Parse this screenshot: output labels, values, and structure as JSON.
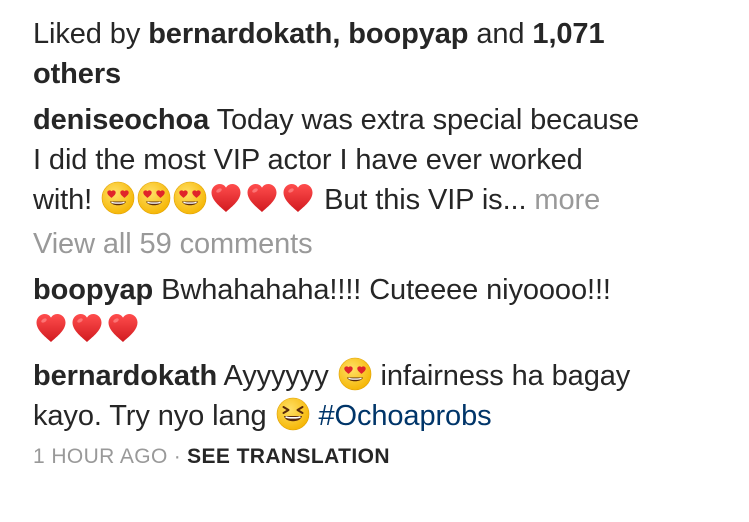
{
  "likes": {
    "prefix": "Liked by",
    "user1": "bernardokath",
    "sep": ",",
    "user2": "boopyap",
    "and": "and",
    "count": "1,071",
    "suffix": "others"
  },
  "caption": {
    "username": "deniseochoa",
    "text_line1": "Today was extra special because",
    "text_line2": "I did the most VIP actor I have ever worked",
    "text_line3_start": "with!",
    "text_after_emojis": "But this VIP is...",
    "more_label": "more",
    "emojis": [
      "heart-eyes-icon",
      "heart-eyes-icon",
      "heart-eyes-icon",
      "red-heart-icon",
      "red-heart-icon",
      "red-heart-icon"
    ]
  },
  "view_all_comments": "View all 59 comments",
  "comments": [
    {
      "username": "boopyap",
      "text": "Bwhahahaha!!!! Cuteeee niyoooo!!!",
      "emojis": [
        "red-heart-icon",
        "red-heart-icon",
        "red-heart-icon"
      ]
    },
    {
      "username": "bernardokath",
      "text_part1": "Ayyyyyy",
      "text_part2": "infairness ha bagay",
      "text_part3": "kayo. Try nyo lang",
      "hashtag": "#Ochoaprobs",
      "emojis": [
        "heart-eyes-icon",
        "laughing-squint-icon"
      ]
    }
  ],
  "meta": {
    "timestamp": "1 HOUR AGO",
    "separator": "·",
    "see_translation": "SEE TRANSLATION"
  },
  "colors": {
    "text": "#262626",
    "muted": "#999999",
    "hashtag": "#003569",
    "heart": "#e0242a",
    "emoji_face": "#ffcc33"
  }
}
